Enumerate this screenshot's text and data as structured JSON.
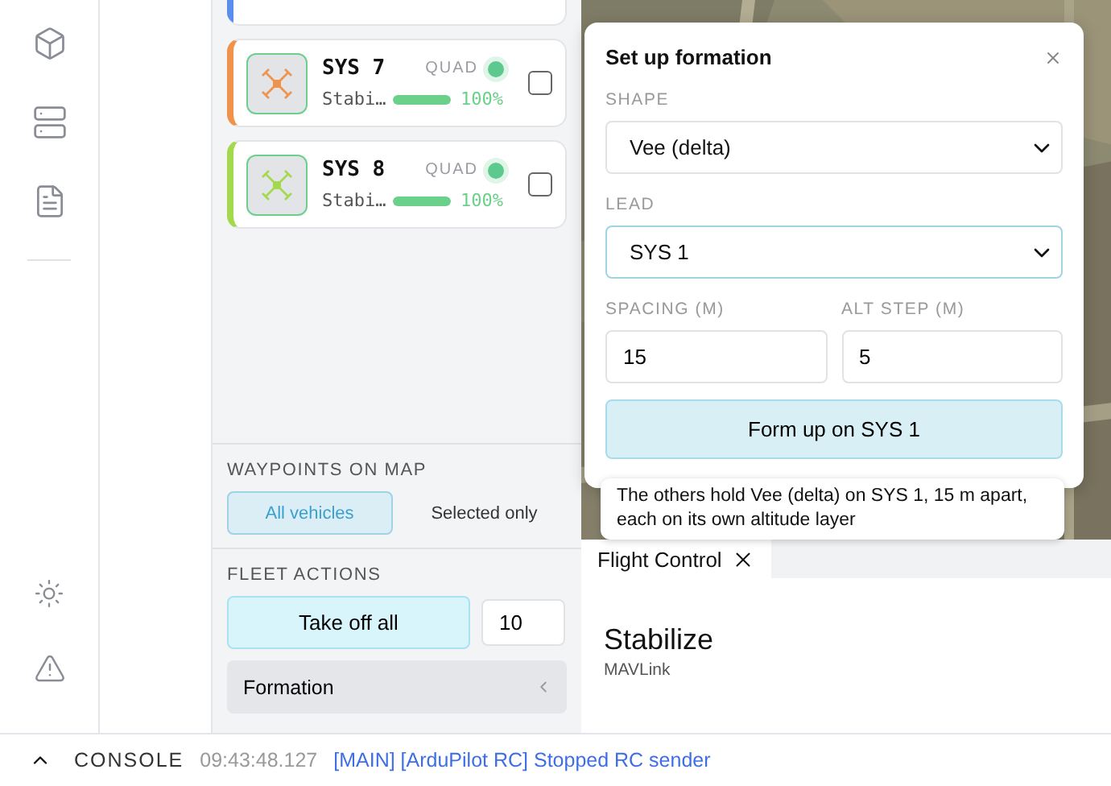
{
  "partial_vehicle": {
    "color": "#5b8def"
  },
  "vehicles": [
    {
      "name": "SYS 7",
      "mode": "Stabi…",
      "type": "QUAD",
      "battery": "100%",
      "level": 1,
      "color": "#f0924a",
      "checked": false
    },
    {
      "name": "SYS 8",
      "mode": "Stabi…",
      "type": "QUAD",
      "battery": "100%",
      "level": 1,
      "color": "#a3d94a",
      "checked": false
    }
  ],
  "waypoints": {
    "label": "WAYPOINTS ON MAP",
    "options": [
      {
        "label": "All vehicles",
        "selected": true
      },
      {
        "label": "Selected only",
        "selected": false
      }
    ]
  },
  "fleet_actions": {
    "label": "FLEET ACTIONS",
    "take_off": "Take off all",
    "altitude": "10",
    "formation": {
      "label": "Formation",
      "expanded": false
    }
  },
  "formation_dialog": {
    "title": "Set up formation",
    "shape": {
      "label": "SHAPE",
      "value": "Vee (delta)"
    },
    "lead": {
      "label": "LEAD",
      "value": "SYS 1"
    },
    "spacing": {
      "label": "SPACING (M)",
      "value": "15"
    },
    "alt_step": {
      "label": "ALT STEP (M)",
      "value": "5"
    },
    "submit": "Form up on SYS 1",
    "tooltip": "The others hold Vee (delta) on SYS 1, 15 m apart, each on its own altitude layer"
  },
  "tabs": [
    {
      "label": "Flight Control",
      "selected": true
    }
  ],
  "flight_panel": {
    "mode": "Stabilize",
    "source": "MAVLink"
  },
  "console": {
    "label": "CONSOLE",
    "time": "09:43:48.127",
    "message": "[MAIN] [ArduPilot RC] Stopped RC sender"
  }
}
